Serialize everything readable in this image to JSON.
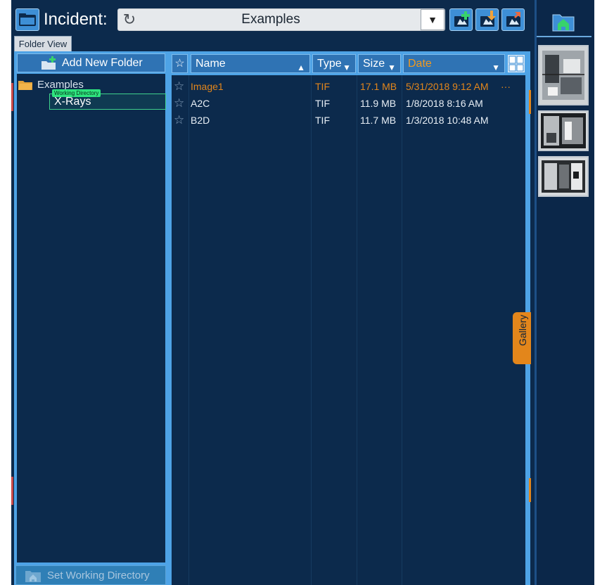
{
  "incident": {
    "label": "Incident:",
    "value": "Examples"
  },
  "toolbar": {
    "import_icon": "import-image-icon",
    "export_icon": "export-image-icon",
    "share_icon": "share-image-icon"
  },
  "folder_view": {
    "tab_label": "Folder View",
    "add_folder_label": "Add New Folder",
    "tree": {
      "root": "Examples",
      "child": "X-Rays",
      "working_badge": "Working Directory"
    },
    "set_working_dir_label": "Set Working Directory"
  },
  "file_list": {
    "columns": {
      "star": "☆",
      "name": "Name",
      "type": "Type",
      "size": "Size",
      "date": "Date"
    },
    "rows": [
      {
        "name": "Image1",
        "type": "TIF",
        "size": "17.1 MB",
        "date": "5/31/2018  9:12 AM",
        "more": "···"
      },
      {
        "name": "A2C",
        "type": "TIF",
        "size": "11.9 MB",
        "date": "1/8/2018  8:16 AM",
        "more": ""
      },
      {
        "name": "B2D",
        "type": "TIF",
        "size": "11.7 MB",
        "date": "1/3/2018  10:48 AM",
        "more": ""
      }
    ]
  },
  "gallery": {
    "tab_label": "Gallery"
  },
  "colors": {
    "accent": "#4ea3e6",
    "background": "#0c2a4c",
    "highlight": "#e3861b",
    "working_dir": "#2ee47e"
  }
}
